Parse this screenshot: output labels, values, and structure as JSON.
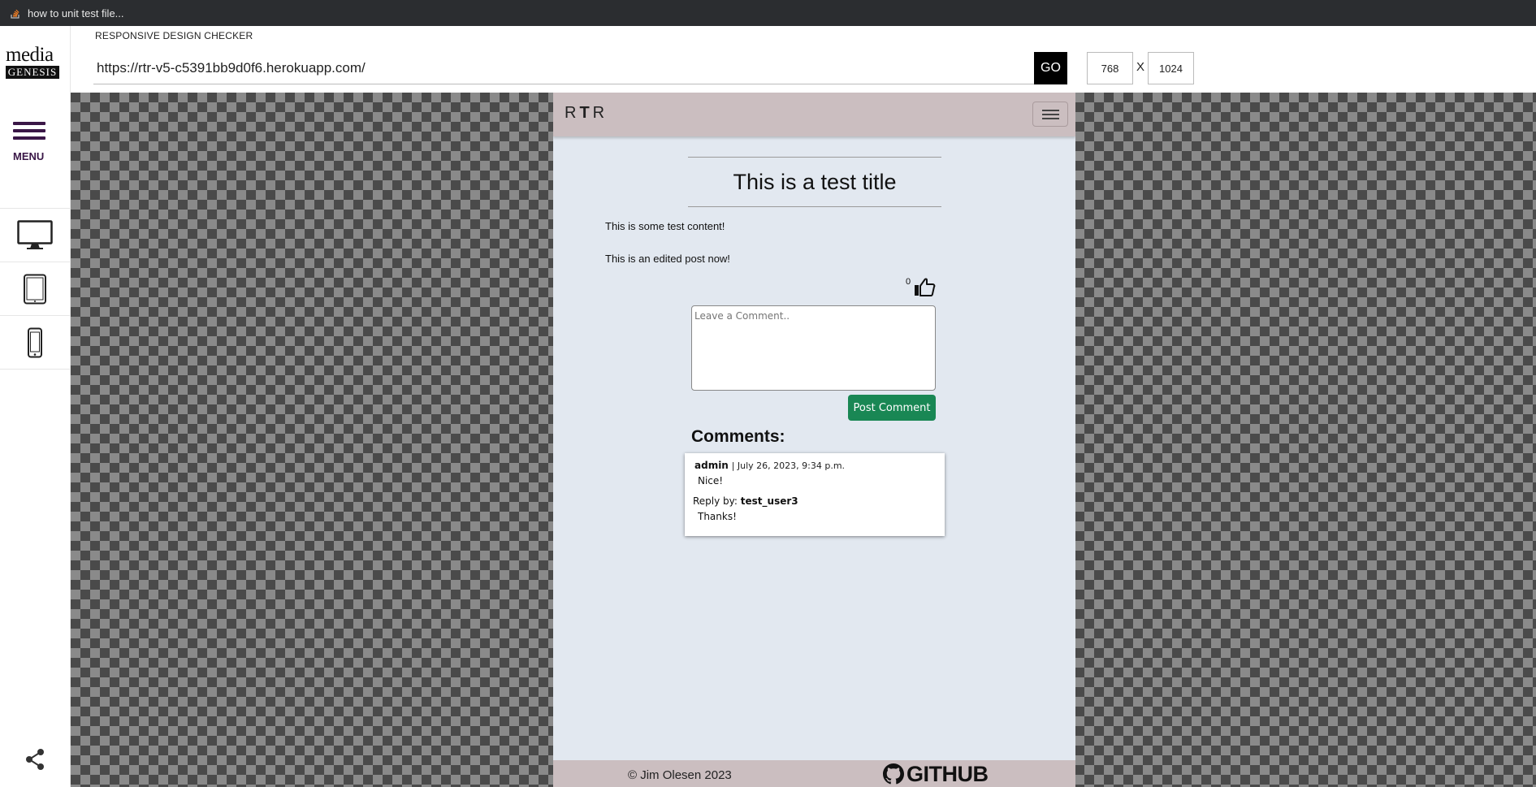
{
  "window": {
    "tab_title": "how to unit test file...",
    "tab_icon": "stack-overflow-icon"
  },
  "sidebar": {
    "logo_top": "media",
    "logo_bottom": "GENESIS",
    "menu_label": "MENU",
    "devices": [
      "desktop-icon",
      "tablet-icon",
      "phone-icon"
    ],
    "share_icon": "share-icon"
  },
  "toolbar": {
    "app_label": "RESPONSIVE DESIGN CHECKER",
    "url": "https://rtr-v5-c5391bb9d0f6.herokuapp.com/",
    "go_label": "GO",
    "width_value": "768",
    "times_label": "X",
    "height_value": "1024"
  },
  "site": {
    "brand_left": "R",
    "brand_mid": "T",
    "brand_right": "R",
    "post_title": "This is a test title",
    "content_line_1": "This is some test content!",
    "content_line_2": "This is an edited post now!",
    "like_count": "0",
    "comment_placeholder": "Leave a Comment..",
    "post_comment_label": "Post Comment",
    "comments_heading": "Comments:",
    "comments": [
      {
        "author": "admin",
        "date": "| July 26, 2023, 9:34 p.m.",
        "body": "Nice!",
        "reply_prefix": "Reply by:",
        "reply_author": "test_user3",
        "reply_body": "Thanks!"
      }
    ],
    "footer_copyright": "© Jim Olesen 2023",
    "footer_github": "GITHUB"
  },
  "colors": {
    "navbar": "#cbbec0",
    "page_bg": "#e2e8f0",
    "post_button": "#198754",
    "menu_accent": "#3a1747"
  }
}
